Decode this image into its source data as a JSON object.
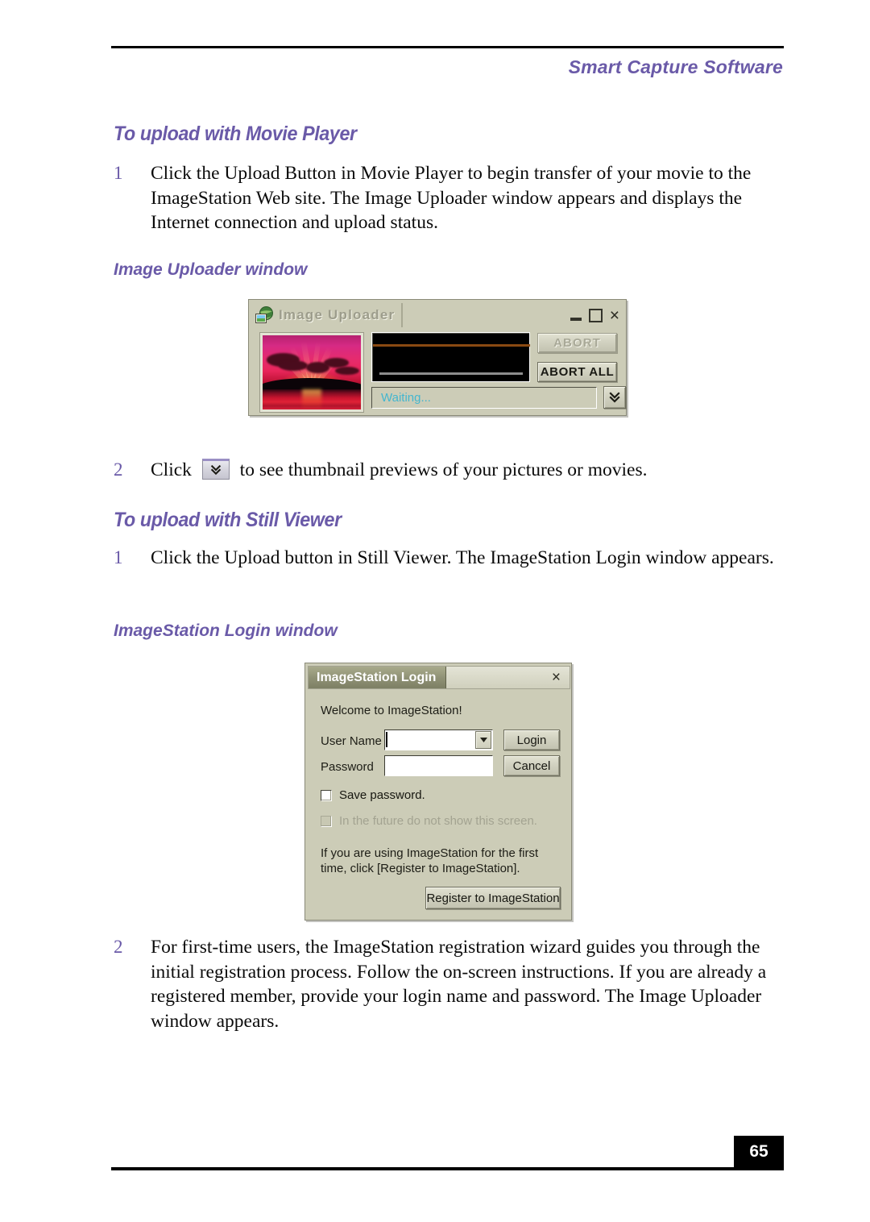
{
  "page": {
    "running_head": "Smart Capture Software",
    "page_number": "65",
    "accent_color": "#6a5aa8",
    "body_text_color": "#0b0b0b"
  },
  "sections": [
    {
      "heading": "To upload with Movie Player",
      "steps": [
        {
          "number": "1",
          "text": "Click the Upload Button in Movie Player to begin transfer of your movie to the ImageStation Web site. The Image Uploader window appears and displays the Internet connection and upload status."
        }
      ],
      "subheading": "Image Uploader window",
      "step2": {
        "number": "2",
        "text_before": "Click",
        "icon": "chevron-double-down-icon",
        "text_after": "to see thumbnail previews of your pictures or movies."
      }
    },
    {
      "heading": "To upload with Still Viewer",
      "steps": [
        {
          "number": "1",
          "text": "Click the Upload button in Still Viewer. The ImageStation Login window appears."
        }
      ],
      "subheading": "ImageStation Login window",
      "step2": {
        "number": "2",
        "text": "For first-time users, the ImageStation registration wizard guides you through the initial registration process. Follow the on-screen instructions. If you are already a registered member, provide your login name and password. The Image Uploader window appears."
      }
    }
  ],
  "uploader_window": {
    "title": "Image Uploader",
    "app_icon": "globe-photo-icon",
    "window_controls": {
      "minimize": "minimize-icon",
      "maximize": "maximize-icon",
      "close": "×"
    },
    "thumbnail_alt": "sunset-photo-thumbnail",
    "buttons": {
      "abort": "ABORT",
      "abort_disabled": true,
      "abort_all": "ABORT ALL"
    },
    "status_text": "Waiting...",
    "status_color": "#44b6cf",
    "expand_icon": "chevron-double-down-icon",
    "progress_bar_colors": [
      "#8a4a12",
      "#8d8d8d"
    ]
  },
  "login_window": {
    "title": "ImageStation Login",
    "close": "×",
    "welcome": "Welcome to ImageStation!",
    "fields": [
      {
        "label": "User Name",
        "value": "",
        "type": "combobox"
      },
      {
        "label": "Password",
        "value": "",
        "type": "password"
      }
    ],
    "buttons": {
      "login": "Login",
      "cancel": "Cancel",
      "register": "Register to ImageStation"
    },
    "checkboxes": [
      {
        "label": "Save password.",
        "checked": false,
        "disabled": false
      },
      {
        "label": "In the future do not show this screen.",
        "checked": false,
        "disabled": true
      }
    ],
    "hint": "If you are using ImageStation for the first time, click [Register to ImageStation]."
  }
}
